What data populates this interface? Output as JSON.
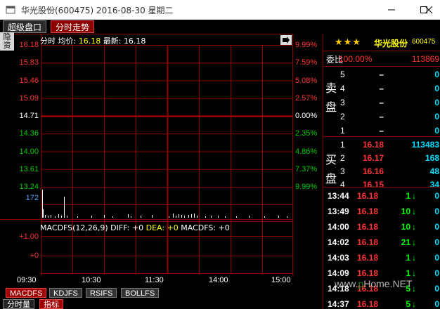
{
  "window": {
    "title": "华光股份(600475) 2016-08-30 星期二",
    "minimize_icon": "minimize-icon",
    "maximize_icon": "maximize-icon",
    "close_icon": "close-icon"
  },
  "top_tabs": [
    "超级盘口",
    "分时走势"
  ],
  "side_tab": "隐\n资",
  "chart": {
    "header_label": "分时",
    "avg_label": "均价:",
    "avg_value": "16.18",
    "latest_label": "最新:",
    "latest_value": "16.18",
    "expand_icon": "arrow-right-icon",
    "price_labels_left": [
      "16.18",
      "15.83",
      "15.46",
      "15.09",
      "14.71",
      "14.36",
      "14.00",
      "13.61",
      "13.24"
    ],
    "pct_labels_right": [
      "9.99%",
      "7.59%",
      "5.08%",
      "2.57%",
      "0.00%",
      "2.35%",
      "4.86%",
      "7.37%",
      "9.99%"
    ],
    "volume_label": "172",
    "macd_text": "MACDFS(12,26,9)",
    "macd_diff": "DIFF: +0",
    "macd_dea": "DEA: +0",
    "macd_fs": "MACDFS: +0",
    "macd_y_labels": [
      "+1.00",
      "+0"
    ],
    "time_labels": [
      "09:30",
      "10:30",
      "11:30",
      "14:00",
      "15:00"
    ],
    "colors": {
      "red": "#ff3333",
      "green": "#00cc00",
      "grid": "#8b0000",
      "white": "#ffffff",
      "yellow": "#ffff00"
    }
  },
  "bottom_tabs": [
    "MACDFS",
    "KDJFS",
    "RSIFS",
    "BOLLFS"
  ],
  "bottom_tabs2": [
    "分时量",
    "指标"
  ],
  "right_panel": {
    "stars": "★★★",
    "name": "华光股份",
    "code": "600475",
    "weibi_label": "委比",
    "weibi_ratio": "100.00%",
    "weibi_diff": "113869",
    "sell_label": "卖\n盘",
    "buy_label": "买\n盘",
    "sell_orders": [
      {
        "level": "5",
        "price": "–",
        "vol": "0"
      },
      {
        "level": "4",
        "price": "–",
        "vol": "0"
      },
      {
        "level": "3",
        "price": "–",
        "vol": "0"
      },
      {
        "level": "2",
        "price": "–",
        "vol": "0"
      },
      {
        "level": "1",
        "price": "–",
        "vol": "0"
      }
    ],
    "buy_orders": [
      {
        "level": "1",
        "price": "16.18",
        "vol": "113483"
      },
      {
        "level": "2",
        "price": "16.17",
        "vol": "168"
      },
      {
        "level": "3",
        "price": "16.16",
        "vol": "48"
      },
      {
        "level": "4",
        "price": "16.15",
        "vol": "34"
      }
    ],
    "ticks": [
      {
        "time": "13:44",
        "price": "16.18",
        "vol": "1",
        "n": "0"
      },
      {
        "time": "13:49",
        "price": "16.18",
        "vol": "10",
        "n": "0"
      },
      {
        "time": "14:00",
        "price": "16.18",
        "vol": "10",
        "n": "0"
      },
      {
        "time": "14:02",
        "price": "16.18",
        "vol": "21",
        "n": "0"
      },
      {
        "time": "14:03",
        "price": "16.18",
        "vol": "1",
        "n": "0"
      },
      {
        "time": "14:09",
        "price": "16.18",
        "vol": "1",
        "n": "0"
      },
      {
        "time": "14:18",
        "price": "16.18",
        "vol": "5",
        "n": "0"
      },
      {
        "time": "14:37",
        "price": "16.18",
        "vol": "5",
        "n": "0"
      }
    ],
    "down_arrow": "↓"
  },
  "watermark": "www.pHome.NET"
}
